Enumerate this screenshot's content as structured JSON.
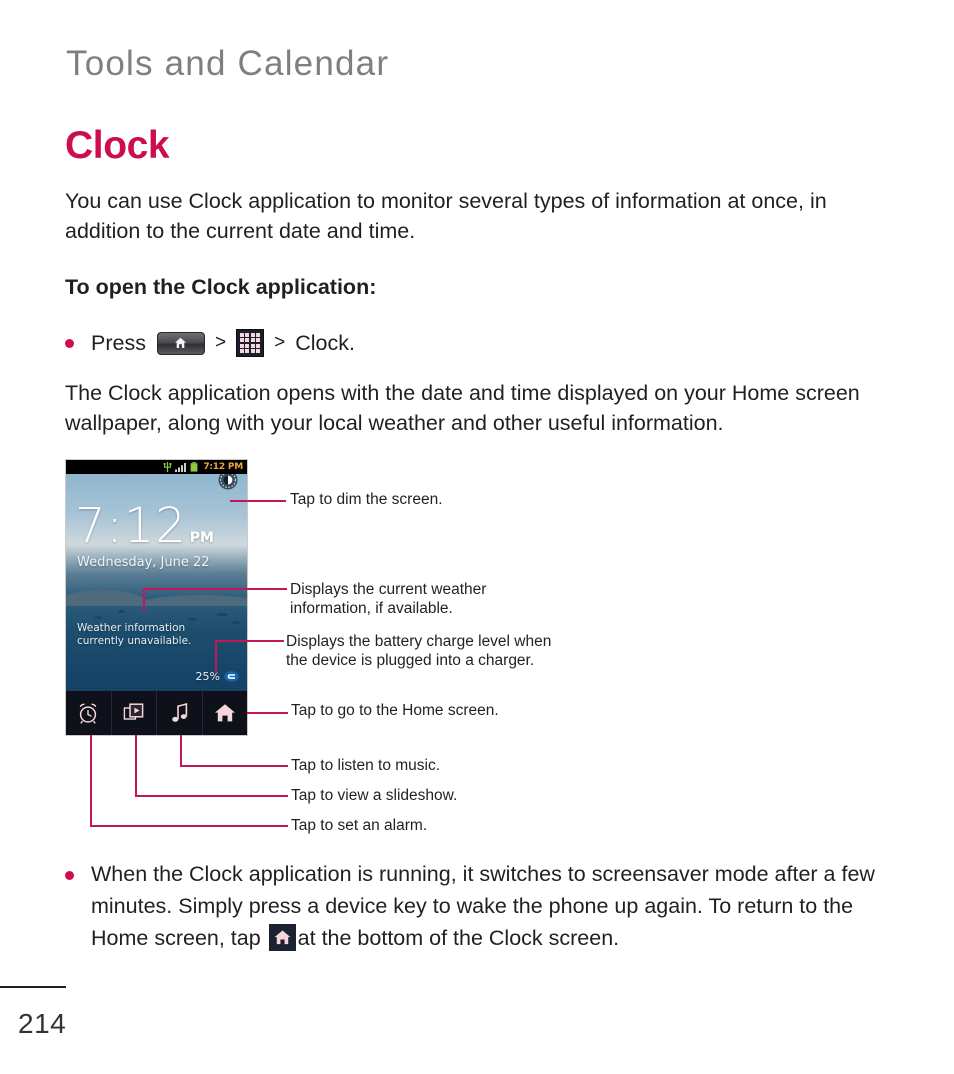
{
  "header": {
    "chapter": "Tools and Calendar"
  },
  "section": {
    "title": "Clock",
    "intro": "You can use Clock application to monitor several types of information at once, in addition to the current date and time.",
    "open_heading": "To open the Clock application:",
    "opens_paragraph": "The Clock application opens with the date and time displayed on your Home screen wallpaper, along with your local weather and other useful information."
  },
  "press_bullet": {
    "press_label": "Press",
    "home_key_icon": "home-key-icon",
    "separator_1": ">",
    "apps_grid_icon": "apps-grid-icon",
    "separator_2": ">",
    "target": "Clock."
  },
  "phone": {
    "statusbar": {
      "usb_icon": "usb-sync-icon",
      "signal_icon": "signal-bars-icon",
      "battery_icon": "battery-icon",
      "time": "7:12 PM"
    },
    "dim_icon": "brightness-dim-icon",
    "time": "7:12",
    "ampm": "PM",
    "date": "Wednesday, June 22",
    "weather_text": "Weather information currently unavailable.",
    "battery_percent": "25%",
    "charge_icon": "charging-icon",
    "dock": [
      {
        "icon": "alarm-clock-icon",
        "name": "alarm"
      },
      {
        "icon": "slideshow-icon",
        "name": "slideshow"
      },
      {
        "icon": "music-note-icon",
        "name": "music"
      },
      {
        "icon": "home-icon",
        "name": "home"
      }
    ]
  },
  "callouts": {
    "dim": "Tap to dim the screen.",
    "weather": "Displays the current weather\ninformation, if available.",
    "battery": "Displays the battery charge level when\nthe device is plugged into a charger.",
    "home": "Tap to go to the Home screen.",
    "music": "Tap to listen to music.",
    "slideshow": "Tap to view a slideshow.",
    "alarm": "Tap to set an alarm."
  },
  "final_bullet": {
    "text_before": "When the Clock application is running, it switches to screensaver mode after a few minutes. Simply press a device key to wake the phone up again. To return to the Home screen, tap ",
    "inline_icon": "home-icon",
    "text_after": "at the bottom of the Clock screen."
  },
  "footer": {
    "page_number": "214"
  },
  "colors": {
    "accent": "#cc0e4e",
    "leader": "#c2185b",
    "chapter_gray": "#7f7f7f",
    "body": "#231f20",
    "status_time": "#f0a43a"
  }
}
